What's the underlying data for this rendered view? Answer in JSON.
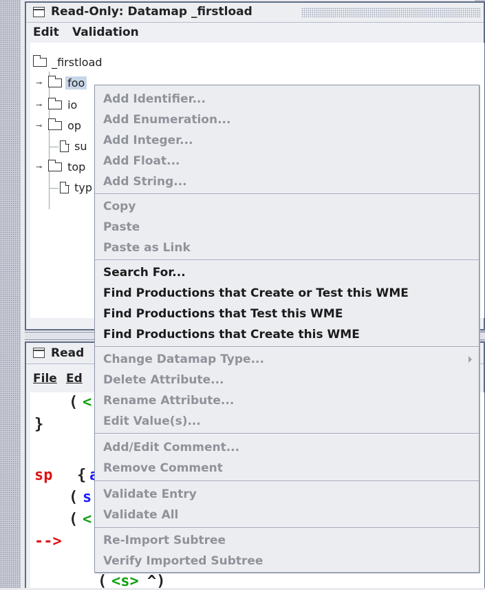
{
  "datamap_window": {
    "title": "Read-Only: Datamap _firstload",
    "menu": [
      "Edit",
      "Validation"
    ]
  },
  "tree": {
    "root": "_firstload",
    "children": [
      {
        "label": "foo",
        "kind": "folder",
        "expandable": true,
        "selected": true
      },
      {
        "label": "io",
        "kind": "folder",
        "expandable": true
      },
      {
        "label": "op",
        "kind": "folder",
        "expandable": true
      },
      {
        "label": "su",
        "kind": "file",
        "expandable": false
      },
      {
        "label": "top",
        "kind": "folder",
        "expandable": true
      },
      {
        "label": "typ",
        "kind": "file",
        "expandable": false
      }
    ]
  },
  "editor_window": {
    "title": "Read",
    "menu": [
      "File",
      "Ed"
    ],
    "code_fragments": {
      "l1_open": "(",
      "l1_lt": "<",
      "l2": "}",
      "l3_sp": "sp",
      "l3_brace": "{",
      "l3_a": "a",
      "l4_open": "(",
      "l4_s": "s",
      "l5_open": "(",
      "l5_lt": "<",
      "l6_arrow": "-->",
      "l7_open": "(",
      "l7_var": "<s>",
      "l7_caret": "^)"
    }
  },
  "context_menu": {
    "groups": [
      {
        "items": [
          {
            "label": "Add Identifier...",
            "enabled": false
          },
          {
            "label": "Add Enumeration...",
            "enabled": false
          },
          {
            "label": "Add Integer...",
            "enabled": false
          },
          {
            "label": "Add Float...",
            "enabled": false
          },
          {
            "label": "Add String...",
            "enabled": false
          }
        ]
      },
      {
        "items": [
          {
            "label": "Copy",
            "enabled": false
          },
          {
            "label": "Paste",
            "enabled": false
          },
          {
            "label": "Paste as Link",
            "enabled": false
          }
        ]
      },
      {
        "items": [
          {
            "label": "Search For...",
            "enabled": true
          },
          {
            "label": "Find Productions that Create or Test this WME",
            "enabled": true
          },
          {
            "label": "Find Productions that Test this WME",
            "enabled": true
          },
          {
            "label": "Find Productions that Create this WME",
            "enabled": true
          }
        ]
      },
      {
        "items": [
          {
            "label": "Change Datamap Type...",
            "enabled": false,
            "submenu": true
          },
          {
            "label": "Delete Attribute...",
            "enabled": false
          },
          {
            "label": "Rename Attribute...",
            "enabled": false
          },
          {
            "label": "Edit Value(s)...",
            "enabled": false
          }
        ]
      },
      {
        "items": [
          {
            "label": "Add/Edit Comment...",
            "enabled": false
          },
          {
            "label": "Remove Comment",
            "enabled": false
          }
        ]
      },
      {
        "items": [
          {
            "label": "Validate Entry",
            "enabled": false
          },
          {
            "label": "Validate All",
            "enabled": false
          }
        ]
      },
      {
        "items": [
          {
            "label": "Re-Import Subtree",
            "enabled": false
          },
          {
            "label": "Verify Imported Subtree",
            "enabled": false
          }
        ]
      }
    ]
  },
  "colors": {
    "disabled_text": "#8f9299",
    "enabled_text": "#1b1b1b",
    "selection": "#c8d6e8",
    "keyword_red": "#e01010",
    "variable_green": "#11a011",
    "symbol_blue": "#1a1aff"
  }
}
